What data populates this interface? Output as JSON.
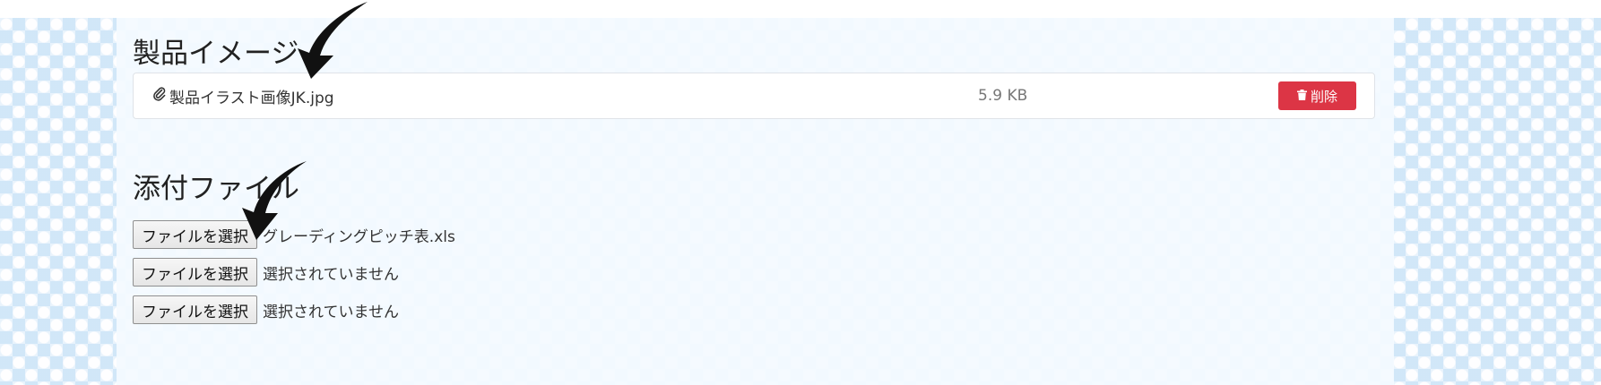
{
  "sections": {
    "product_image": {
      "heading": "製品イメージ",
      "file": {
        "icon": "paperclip-icon",
        "name": "製品イラスト画像JK.jpg",
        "size": "5.9 KB",
        "delete_icon": "trash-icon",
        "delete_label": "削除",
        "delete_color": "#dc3545"
      }
    },
    "attachments": {
      "heading": "添付ファイル",
      "inputs": [
        {
          "button_label": "ファイルを選択",
          "status": "グレーディングピッチ表.xls"
        },
        {
          "button_label": "ファイルを選択",
          "status": "選択されていません"
        },
        {
          "button_label": "ファイルを選択",
          "status": "選択されていません"
        }
      ]
    }
  },
  "annotations": [
    {
      "icon": "black-arrow-icon",
      "target": "product-file-name"
    },
    {
      "icon": "black-arrow-icon",
      "target": "file-input-1"
    }
  ],
  "colors": {
    "page_background": "#e9f3fc",
    "panel_background": "#f4faff",
    "danger": "#dc3545"
  }
}
